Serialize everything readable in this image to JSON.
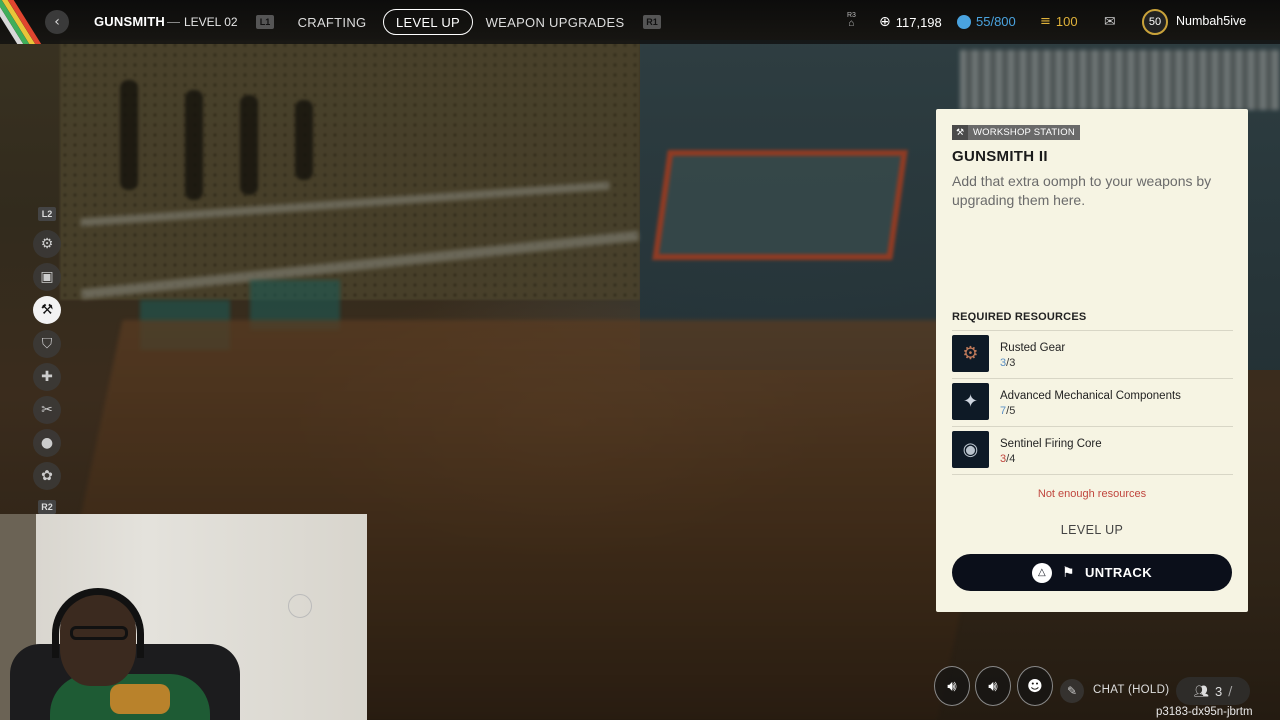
{
  "topbar": {
    "back_icon": "‹",
    "title": "GUNSMITH",
    "separator": "—",
    "level": "LEVEL 02",
    "hint_left": "L1",
    "hint_right": "R1",
    "tabs": [
      {
        "label": "CRAFTING",
        "active": false
      },
      {
        "label": "LEVEL UP",
        "active": true
      },
      {
        "label": "WEAPON UPGRADES",
        "active": false
      }
    ],
    "r3_hint": "R3",
    "coins": "117,198",
    "tokens": "55/800",
    "cred": "100",
    "player_level": "50",
    "username": "Numbah5ive"
  },
  "sidebar": {
    "hint_top": "L2",
    "hint_bottom": "R2",
    "items": [
      {
        "icon": "workbench-icon",
        "glyph": "⚙",
        "active": false
      },
      {
        "icon": "medical-station-icon",
        "glyph": "▣",
        "active": false
      },
      {
        "icon": "gunsmith-icon",
        "glyph": "⚒",
        "active": true
      },
      {
        "icon": "gear-armor-icon",
        "glyph": "⛉",
        "active": false
      },
      {
        "icon": "medic-cross-icon",
        "glyph": "✚",
        "active": false
      },
      {
        "icon": "tools-icon",
        "glyph": "✂",
        "active": false
      },
      {
        "icon": "explosives-icon",
        "glyph": "●",
        "active": false
      },
      {
        "icon": "utility-icon",
        "glyph": "✿",
        "active": false
      }
    ]
  },
  "panel": {
    "badge": "WORKSHOP STATION",
    "title": "GUNSMITH II",
    "description": "Add that extra oomph to your weapons by upgrading them here.",
    "required_title": "REQUIRED RESOURCES",
    "resources": [
      {
        "name": "Rusted Gear",
        "have": "3",
        "need": "3",
        "sufficient": true,
        "icon": "rusted-gear-icon",
        "glyph": "⚙"
      },
      {
        "name": "Advanced Mechanical Components",
        "have": "7",
        "need": "5",
        "sufficient": true,
        "icon": "mechanical-components-icon",
        "glyph": "✦"
      },
      {
        "name": "Sentinel Firing Core",
        "have": "3",
        "need": "4",
        "sufficient": false,
        "icon": "firing-core-icon",
        "glyph": "◉"
      }
    ],
    "warning": "Not enough resources",
    "level_up_label": "LEVEL UP",
    "untrack_label": "UNTRACK"
  },
  "hud": {
    "chat_label": "CHAT (HOLD)",
    "party_count": "3",
    "session_id": "p3183-dx95n-jbrtm"
  },
  "colors": {
    "have_ok": "#5a8fc4",
    "have_low": "#c0463e",
    "token_blue": "#4aa3df",
    "cred_gold": "#e0b23a"
  }
}
